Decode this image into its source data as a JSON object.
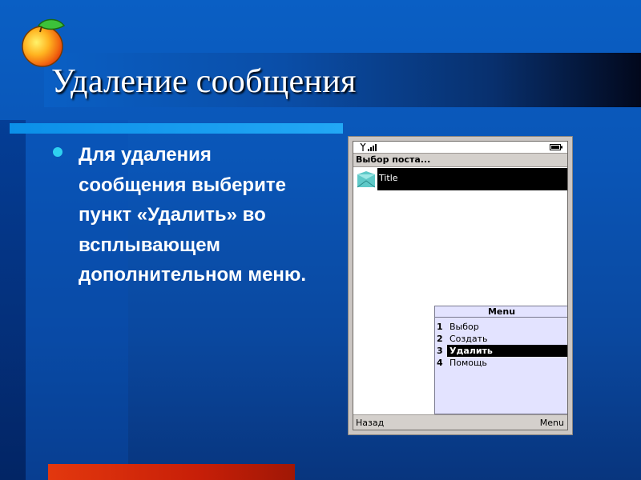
{
  "slide": {
    "title": "Удаление сообщения",
    "bullet_text": "Для удаления сообщения выберите пункт «Удалить» во всплывающем дополнительном меню."
  },
  "phone": {
    "screen_title": "Выбор поста...",
    "list_item_label": "Title",
    "menu": {
      "header": "Menu",
      "items": [
        {
          "num": "1",
          "label": "Выбор"
        },
        {
          "num": "2",
          "label": "Создать"
        },
        {
          "num": "3",
          "label": "Удалить"
        },
        {
          "num": "4",
          "label": "Помощь"
        }
      ],
      "selected_index": 2
    },
    "softkeys": {
      "left": "Назад",
      "right": "Menu"
    }
  },
  "colors": {
    "title_text": "#ffffff",
    "bullet": "#2fd1f0",
    "accent_bar": "#0b8fe8",
    "bottom_bar": "#e3380e",
    "menu_bg": "#e3e3ff"
  },
  "icons": [
    "apple-logo-icon",
    "bullet-dot-icon",
    "signal-strength-icon",
    "battery-icon",
    "message-list-item-icon"
  ]
}
